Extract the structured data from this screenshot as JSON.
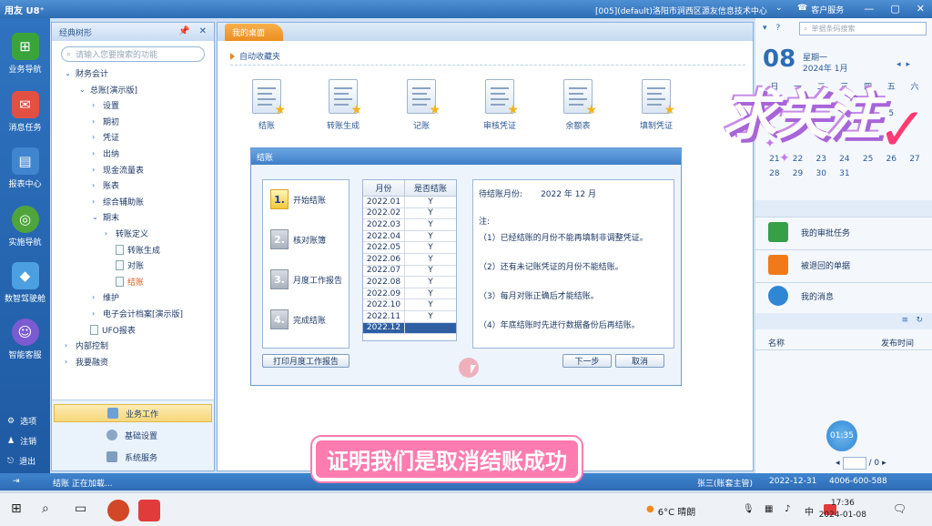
{
  "window": {
    "app_logo": "用友 U8⁺",
    "path": "[005](default)洛阳市涧西区源友信息技术中心",
    "customer_service": "客户服务",
    "question_icon": "?",
    "close_icon": "✕",
    "min_icon": "—",
    "max_icon": "▢"
  },
  "rail": {
    "items": [
      {
        "label": "业务导航",
        "color": "#3aa33c"
      },
      {
        "label": "消息任务",
        "color": "#e25043"
      },
      {
        "label": "报表中心",
        "color": "#3f86cf"
      },
      {
        "label": "实施导航",
        "color": "#4fa53c"
      },
      {
        "label": "数智驾驶舱",
        "color": "#4c9fe0"
      },
      {
        "label": "智能客服",
        "color": "#7b5bd1"
      }
    ],
    "bottom": [
      {
        "label": "选项",
        "icon": "gear-icon"
      },
      {
        "label": "注销",
        "icon": "user-icon"
      },
      {
        "label": "退出",
        "icon": "exit-icon"
      }
    ]
  },
  "tree": {
    "title": "经典树形",
    "search_placeholder": "请输入您要搜索的功能",
    "nodes": [
      {
        "label": "财务会计",
        "level": 1,
        "arrow": "⌄",
        "type": "folder"
      },
      {
        "label": "总账[演示版]",
        "level": 2,
        "arrow": "⌄",
        "type": "folder"
      },
      {
        "label": "设置",
        "level": 3,
        "arrow": "›",
        "type": "folder"
      },
      {
        "label": "期初",
        "level": 3,
        "arrow": "›",
        "type": "folder"
      },
      {
        "label": "凭证",
        "level": 3,
        "arrow": "›",
        "type": "folder"
      },
      {
        "label": "出纳",
        "level": 3,
        "arrow": "›",
        "type": "folder"
      },
      {
        "label": "现金流量表",
        "level": 3,
        "arrow": "›",
        "type": "folder"
      },
      {
        "label": "账表",
        "level": 3,
        "arrow": "›",
        "type": "folder"
      },
      {
        "label": "综合辅助账",
        "level": 3,
        "arrow": "›",
        "type": "folder"
      },
      {
        "label": "期末",
        "level": 3,
        "arrow": "⌄",
        "type": "folder"
      },
      {
        "label": "转账定义",
        "level": 4,
        "arrow": "›",
        "type": "folder"
      },
      {
        "label": "转账生成",
        "level": 4,
        "arrow": "",
        "type": "doc"
      },
      {
        "label": "对账",
        "level": 4,
        "arrow": "",
        "type": "doc"
      },
      {
        "label": "结账",
        "level": 4,
        "arrow": "",
        "type": "doc",
        "selected": true
      },
      {
        "label": "维护",
        "level": 3,
        "arrow": "›",
        "type": "folder"
      },
      {
        "label": "电子会计档案[演示版]",
        "level": 3,
        "arrow": "›",
        "type": "folder"
      },
      {
        "label": "UFO报表",
        "level": 2,
        "arrow": "",
        "type": "doc"
      },
      {
        "label": "内部控制",
        "level": 1,
        "arrow": "›",
        "type": "folder"
      },
      {
        "label": "我要融资",
        "level": 1,
        "arrow": "›",
        "type": "folder"
      }
    ],
    "bottom_items": [
      {
        "label": "业务工作",
        "active": true
      },
      {
        "label": "基础设置",
        "active": false
      },
      {
        "label": "系统服务",
        "active": false
      }
    ]
  },
  "main": {
    "tab": "我的桌面",
    "fav_heading": "自动收藏夹",
    "favorites": [
      {
        "label": "结账"
      },
      {
        "label": "转账生成"
      },
      {
        "label": "记账"
      },
      {
        "label": "审核凭证"
      },
      {
        "label": "余额表"
      },
      {
        "label": "填制凭证"
      }
    ]
  },
  "dialog": {
    "title": "结账",
    "steps": [
      {
        "num": "1.",
        "label": "开始结账",
        "active": true
      },
      {
        "num": "2.",
        "label": "核对账簿",
        "active": false
      },
      {
        "num": "3.",
        "label": "月度工作报告",
        "active": false
      },
      {
        "num": "4.",
        "label": "完成结账",
        "active": false
      }
    ],
    "grid_headers": [
      "月份",
      "是否结账"
    ],
    "rows": [
      {
        "month": "2022.01",
        "closed": "Y"
      },
      {
        "month": "2022.02",
        "closed": "Y"
      },
      {
        "month": "2022.03",
        "closed": "Y"
      },
      {
        "month": "2022.04",
        "closed": "Y"
      },
      {
        "month": "2022.05",
        "closed": "Y"
      },
      {
        "month": "2022.06",
        "closed": "Y"
      },
      {
        "month": "2022.07",
        "closed": "Y"
      },
      {
        "month": "2022.08",
        "closed": "Y"
      },
      {
        "month": "2022.09",
        "closed": "Y"
      },
      {
        "month": "2022.10",
        "closed": "Y"
      },
      {
        "month": "2022.11",
        "closed": "Y"
      },
      {
        "month": "2022.12",
        "closed": "",
        "selected": true
      }
    ],
    "pending_label": "待结账月份:",
    "pending_value": "2022 年 12 月",
    "notes": [
      "注:",
      "（1）已经结账的月份不能再填制非调整凭证。",
      "（2）还有未记账凭证的月份不能结账。",
      "（3）每月对账正确后才能结账。",
      "（4）年底结账时先进行数据备份后再结账。"
    ],
    "print_button": "打印月度工作报告",
    "next_button": "下一步",
    "cancel_button": "取消"
  },
  "right_panel": {
    "search_placeholder": "单据条码搜索",
    "day": "08",
    "weekday": "星期一",
    "month": "2024年 1月",
    "week_headers": [
      "日",
      "一",
      "二",
      "三",
      "四",
      "五",
      "六"
    ],
    "cal_rows": [
      [
        "",
        "",
        "",
        "",
        "",
        "",
        ""
      ],
      [
        "",
        "",
        "",
        "",
        "",
        "5",
        ""
      ],
      [
        "",
        "",
        "",
        "",
        "",
        "",
        ""
      ],
      [
        "",
        "",
        "",
        "",
        "",
        "",
        ""
      ],
      [
        "21",
        "22",
        "23",
        "24",
        "25",
        "26",
        "27"
      ],
      [
        "28",
        "29",
        "30",
        "31",
        "",
        "",
        ""
      ]
    ],
    "tasks": [
      {
        "label": "我的审批任务",
        "color": "#35a046"
      },
      {
        "label": "被退回的单据",
        "color": "#f07a1a"
      },
      {
        "label": "我的消息",
        "color": "#2f86d3"
      }
    ],
    "list_headers": [
      "名称",
      "发布时间"
    ],
    "page_total": "/ 0",
    "timer": "01:35"
  },
  "sticker": {
    "word": "求关注"
  },
  "status": {
    "left": "结账 正在加载...",
    "user": "张三(账套主管)",
    "date": "2022-12-31",
    "phone": "4006-600-588"
  },
  "subtitle": "证明我们是取消结账成功",
  "taskbar": {
    "weather": "6°C 晴朗",
    "ime": "中",
    "time": "17:36",
    "date": "2024-01-08"
  }
}
